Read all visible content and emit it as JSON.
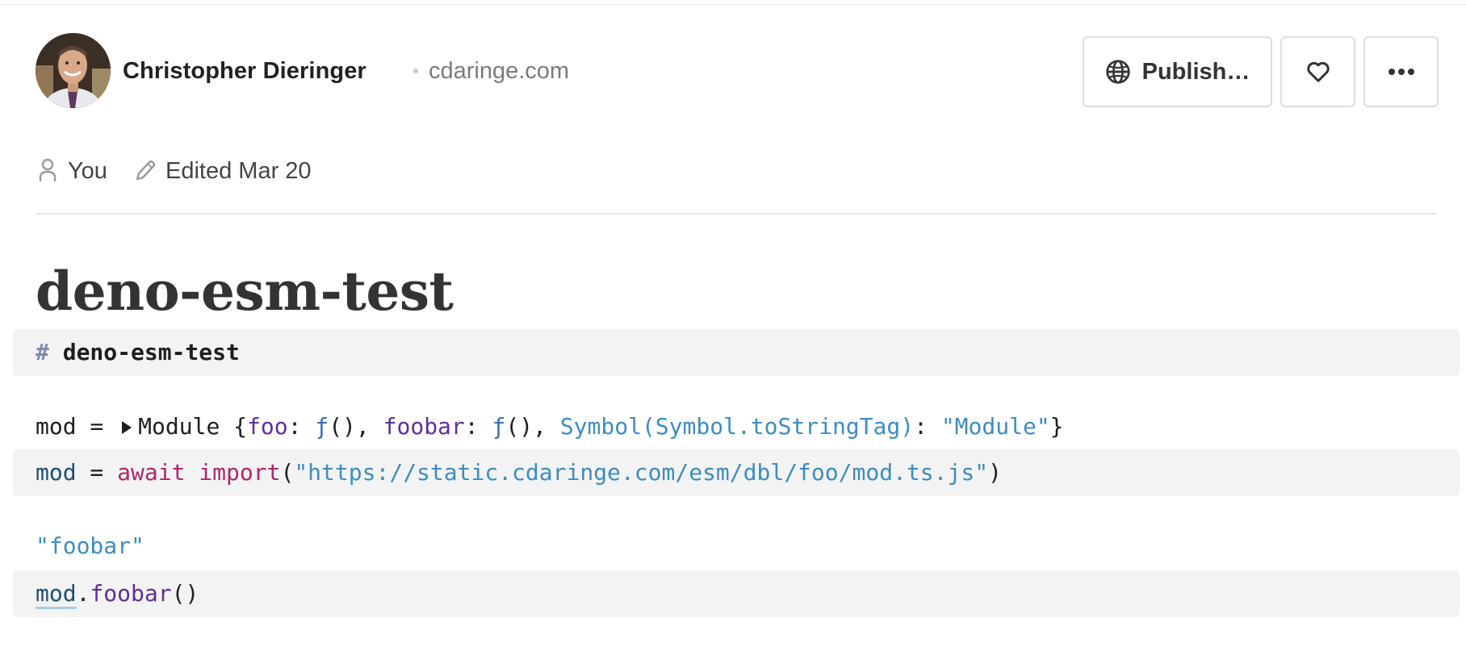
{
  "header": {
    "author_name": "Christopher Dieringer",
    "author_domain": "cdaringe.com",
    "publish_label": "Publish…",
    "like_icon": "heart-icon",
    "more_icon": "more-icon"
  },
  "meta": {
    "owner_label": "You",
    "edited_label": "Edited Mar 20"
  },
  "notebook": {
    "title": "deno-esm-test"
  },
  "cells": {
    "markdown": {
      "hash": "#",
      "heading": "deno-esm-test"
    },
    "module_output": {
      "name": "mod",
      "eq": " = ",
      "type": "Module",
      "open_brace": " {",
      "key1": "foo",
      "sep1": ": ",
      "fn1": "ƒ",
      "parens1": "(), ",
      "key2": "foobar",
      "sep2": ": ",
      "fn2": "ƒ",
      "parens2": "(), ",
      "key3": "Symbol(Symbol.toStringTag)",
      "sep3": ": ",
      "val3": "\"Module\"",
      "close_brace": "}"
    },
    "module_source": {
      "name": "mod",
      "eq": " = ",
      "kw_await": "await",
      "space": " ",
      "kw_import": "import",
      "open": "(",
      "url": "\"https://static.cdaringe.com/esm/dbl/foo/mod.ts.js\"",
      "close": ")"
    },
    "call_output": {
      "value": "\"foobar\""
    },
    "call_source": {
      "obj": "mod",
      "dot": ".",
      "method": "foobar",
      "parens": "()"
    }
  },
  "colors": {
    "keyword": "#b0276a",
    "string": "#3d8dc0",
    "property": "#5e2f9b",
    "variable": "#1d4f73",
    "cell_background": "#f3f3f3"
  }
}
